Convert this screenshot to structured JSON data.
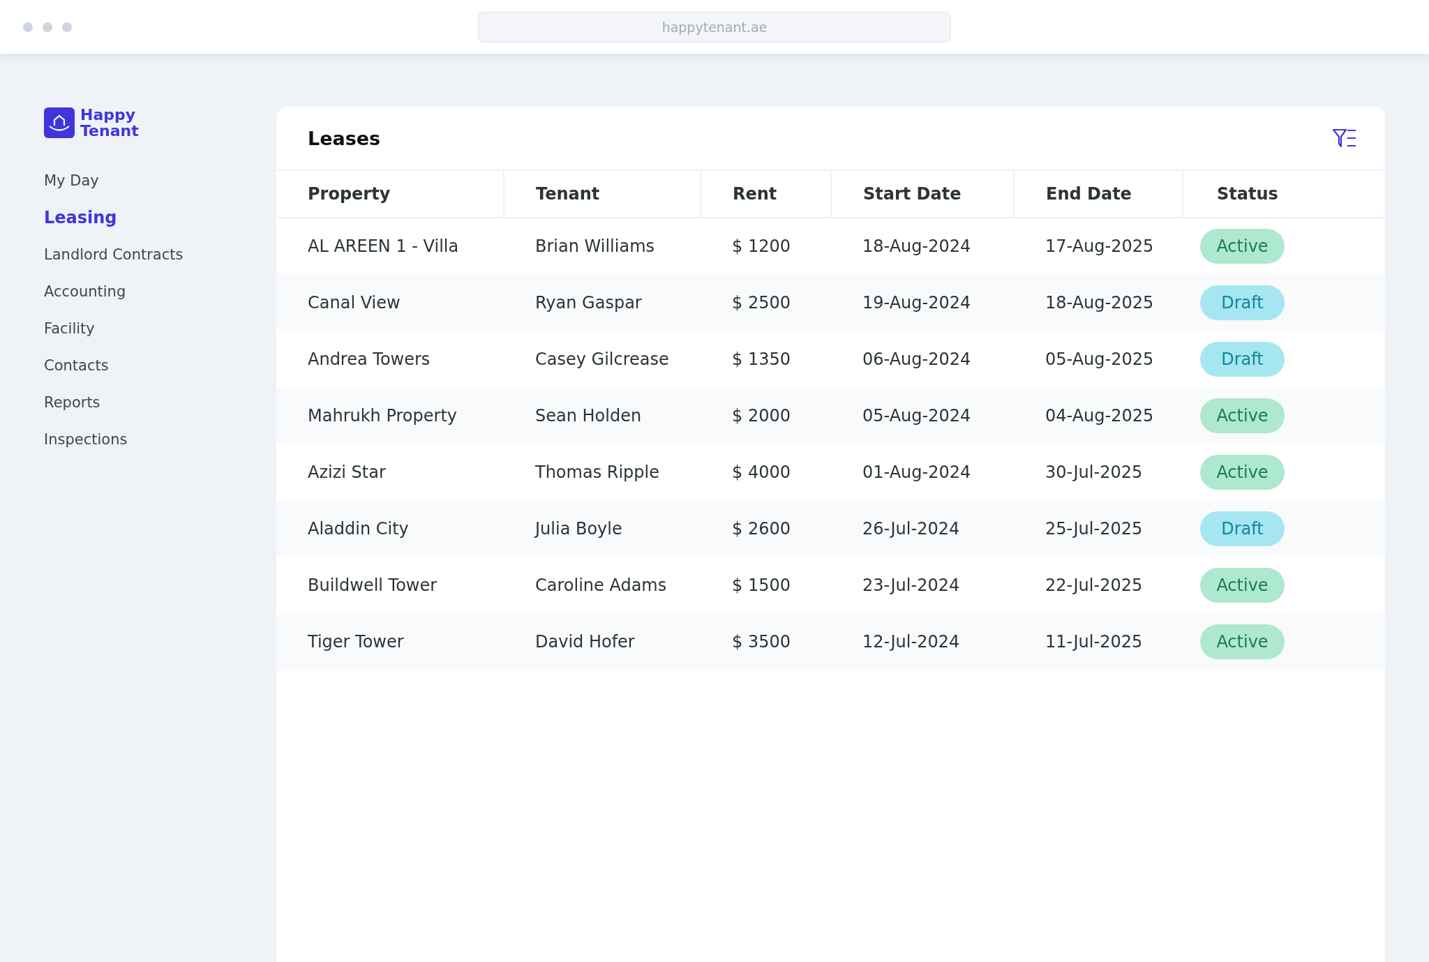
{
  "browser": {
    "url": "happytenant.ae"
  },
  "sidebar": {
    "logo": {
      "line1": "Happy",
      "line2": "Tenant"
    },
    "items": [
      {
        "label": "My Day",
        "selected": false
      },
      {
        "label": "Leasing",
        "selected": true
      },
      {
        "label": "Landlord Contracts",
        "selected": false
      },
      {
        "label": "Accounting",
        "selected": false
      },
      {
        "label": "Facility",
        "selected": false
      },
      {
        "label": "Contacts",
        "selected": false
      },
      {
        "label": "Reports",
        "selected": false
      },
      {
        "label": "Inspections",
        "selected": false
      }
    ]
  },
  "table": {
    "title": "Leases",
    "columns": [
      "Property",
      "Tenant",
      "Rent",
      "Start Date",
      "End Date",
      "Status"
    ],
    "rows": [
      {
        "property": "AL AREEN 1 - Villa",
        "tenant": "Brian Williams",
        "rent": "$ 1200",
        "start": "18-Aug-2024",
        "end": "17-Aug-2025",
        "status": {
          "label": "Active",
          "kind": "active"
        }
      },
      {
        "property": "Canal View",
        "tenant": "Ryan Gaspar",
        "rent": "$ 2500",
        "start": "19-Aug-2024",
        "end": "18-Aug-2025",
        "status": {
          "label": "Draft",
          "kind": "draft"
        }
      },
      {
        "property": "Andrea Towers",
        "tenant": "Casey Gilcrease",
        "rent": "$ 1350",
        "start": "06-Aug-2024",
        "end": "05-Aug-2025",
        "status": {
          "label": "Draft",
          "kind": "draft"
        }
      },
      {
        "property": "Mahrukh Property",
        "tenant": "Sean Holden",
        "rent": "$ 2000",
        "start": "05-Aug-2024",
        "end": "04-Aug-2025",
        "status": {
          "label": "Active",
          "kind": "active"
        }
      },
      {
        "property": "Azizi Star",
        "tenant": "Thomas Ripple",
        "rent": "$ 4000",
        "start": "01-Aug-2024",
        "end": "30-Jul-2025",
        "status": {
          "label": "Active",
          "kind": "active"
        }
      },
      {
        "property": "Aladdin City",
        "tenant": "Julia Boyle",
        "rent": "$ 2600",
        "start": "26-Jul-2024",
        "end": "25-Jul-2025",
        "status": {
          "label": "Draft",
          "kind": "draft"
        }
      },
      {
        "property": "Buildwell Tower",
        "tenant": "Caroline Adams",
        "rent": "$ 1500",
        "start": "23-Jul-2024",
        "end": "22-Jul-2025",
        "status": {
          "label": "Active",
          "kind": "active"
        }
      },
      {
        "property": "Tiger Tower",
        "tenant": "David Hofer",
        "rent": "$ 3500",
        "start": "12-Jul-2024",
        "end": "11-Jul-2025",
        "status": {
          "label": "Active",
          "kind": "active"
        }
      }
    ]
  }
}
